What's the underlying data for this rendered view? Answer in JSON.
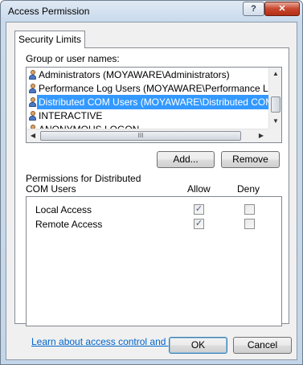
{
  "window": {
    "title": "Access Permission",
    "help_label": "?",
    "close_label": "✕"
  },
  "tabs": [
    {
      "label": "Security Limits",
      "selected": true
    }
  ],
  "group_section": {
    "label": "Group or user names:",
    "items": [
      {
        "label": "Administrators (MOYAWARE\\Administrators)",
        "selected": false
      },
      {
        "label": "Performance Log Users (MOYAWARE\\Performance Log Us...",
        "selected": false
      },
      {
        "label": "Distributed COM Users (MOYAWARE\\Distributed COM Users",
        "selected": true
      },
      {
        "label": "INTERACTIVE",
        "selected": false
      },
      {
        "label": "ANONYMOUS LOGON",
        "selected": false
      }
    ],
    "hscroll_thumb_glyph": "III"
  },
  "buttons": {
    "add": "Add...",
    "remove": "Remove",
    "ok": "OK",
    "cancel": "Cancel"
  },
  "permissions": {
    "label": "Permissions for Distributed COM Users",
    "allow_header": "Allow",
    "deny_header": "Deny",
    "rows": [
      {
        "name": "Local Access",
        "allow": true,
        "deny": false
      },
      {
        "name": "Remote Access",
        "allow": true,
        "deny": false
      }
    ]
  },
  "link_text": "Learn about access control and permissions",
  "colors": {
    "selection": "#3399ff",
    "link": "#0066cc",
    "close_button": "#c7462d"
  }
}
